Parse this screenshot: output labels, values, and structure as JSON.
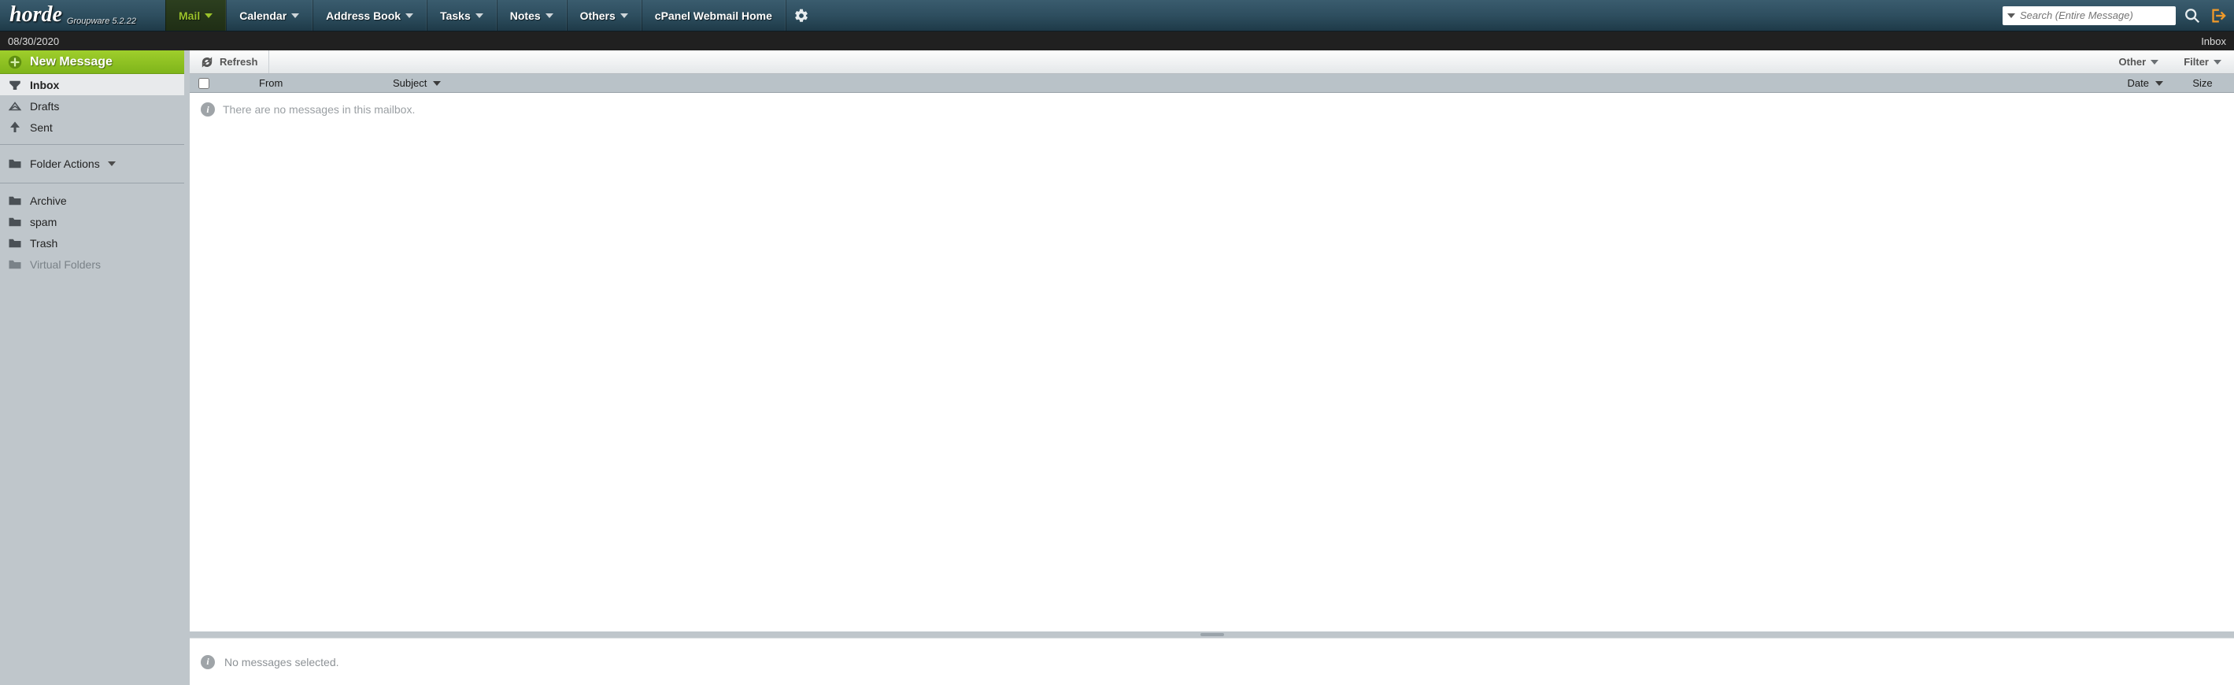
{
  "brand": {
    "name": "horde",
    "tagline": "Groupware 5.2.22"
  },
  "nav": {
    "items": [
      {
        "label": "Mail",
        "active": true,
        "dropdown": true
      },
      {
        "label": "Calendar",
        "active": false,
        "dropdown": true
      },
      {
        "label": "Address Book",
        "active": false,
        "dropdown": true
      },
      {
        "label": "Tasks",
        "active": false,
        "dropdown": true
      },
      {
        "label": "Notes",
        "active": false,
        "dropdown": true
      },
      {
        "label": "Others",
        "active": false,
        "dropdown": true
      },
      {
        "label": "cPanel Webmail Home",
        "active": false,
        "dropdown": false
      }
    ]
  },
  "search": {
    "placeholder": "Search (Entire Message)"
  },
  "substrip": {
    "date": "08/30/2020",
    "folder": "Inbox"
  },
  "sidebar": {
    "new_message": "New Message",
    "mailboxes": [
      {
        "label": "Inbox",
        "icon": "inbox-icon",
        "selected": true
      },
      {
        "label": "Drafts",
        "icon": "drafts-icon",
        "selected": false
      },
      {
        "label": "Sent",
        "icon": "sent-icon",
        "selected": false
      }
    ],
    "folder_actions_label": "Folder Actions",
    "folders": [
      {
        "label": "Archive",
        "muted": false
      },
      {
        "label": "spam",
        "muted": false
      },
      {
        "label": "Trash",
        "muted": false
      },
      {
        "label": "Virtual Folders",
        "muted": true
      }
    ]
  },
  "toolbar": {
    "refresh": "Refresh",
    "other": "Other",
    "filter": "Filter"
  },
  "columns": {
    "from": "From",
    "subject": "Subject",
    "date": "Date",
    "size": "Size"
  },
  "list": {
    "empty_text": "There are no messages in this mailbox."
  },
  "preview": {
    "none_selected": "No messages selected."
  }
}
